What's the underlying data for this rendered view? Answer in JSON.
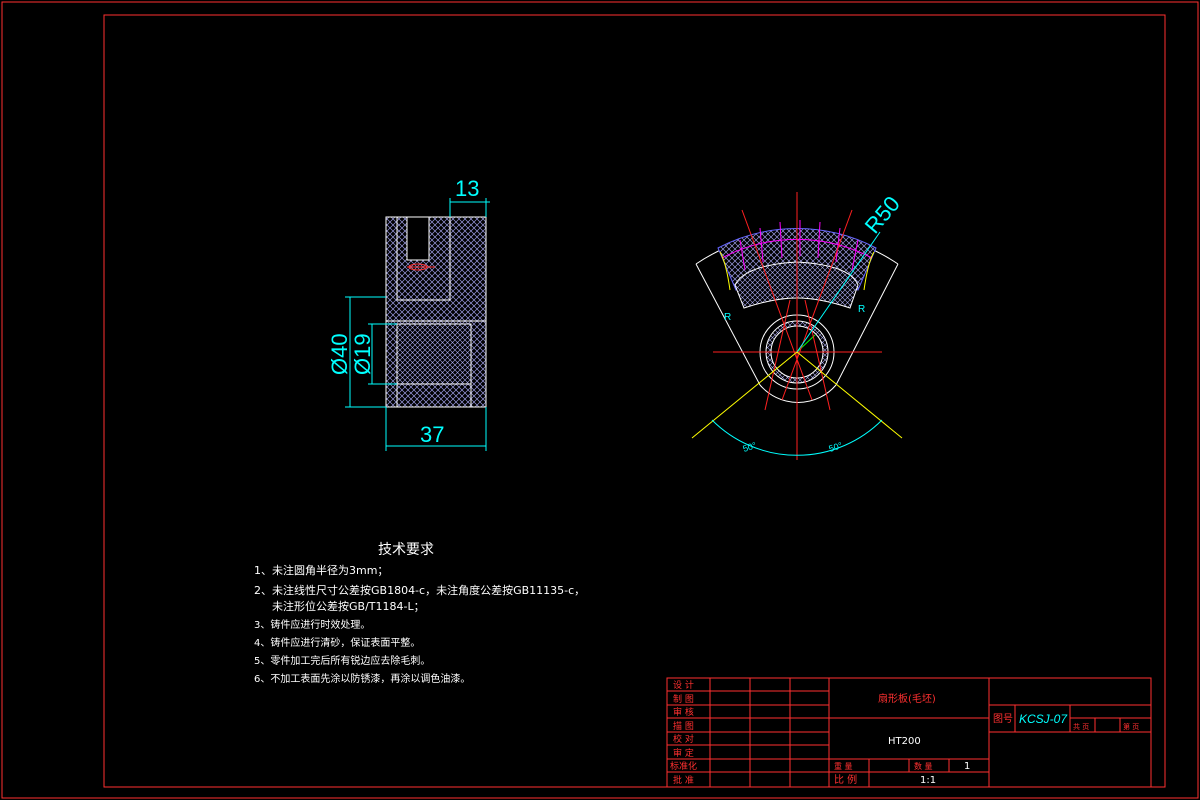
{
  "drawing": {
    "dimensions": {
      "width_top": "13",
      "diameter_outer": "Ø40",
      "diameter_inner": "Ø19",
      "length": "37",
      "radius": "R50",
      "angle_left": "50°",
      "angle_right": "50°",
      "small_r_left": "R",
      "small_r_right": "R"
    }
  },
  "requirements": {
    "title": "技术要求",
    "items": [
      "1、未注圆角半径为3mm；",
      "2、未注线性尺寸公差按GB1804-c，未注角度公差按GB11135-c，",
      "未注形位公差按GB/T1184-L；",
      "3、铸件应进行时效处理。",
      "4、铸件应进行清砂，保证表面平整。",
      "5、零件加工完后所有锐边应去除毛刺。",
      "6、不加工表面先涂以防锈漆，再涂以调色油漆。"
    ]
  },
  "title_block": {
    "roles": [
      "设 计",
      "制 图",
      "审 核",
      "描 图",
      "校 对",
      "审 定",
      "标准化",
      "批 准"
    ],
    "part_name": "扇形板(毛坯)",
    "material": "HT200",
    "drawing_no_label": "图号",
    "drawing_no": "KCSJ-07",
    "sheet_labels": [
      "共 页",
      "第 页"
    ],
    "weight_label": "重 量",
    "count_label": "数 量",
    "count_value": "1",
    "scale_label": "比 例",
    "scale_value": "1:1"
  },
  "colors": {
    "frame": "#ff3030",
    "dimension": "#00ffff",
    "center": "#ff2020",
    "hatch_light": "#aaaaff",
    "hatch_dark": "#8888cc",
    "outline": "#ffffff",
    "gear_magenta": "#ff00ff",
    "gear_blue": "#6666ff",
    "guide_yellow": "#ffff00",
    "label": "#ffffff"
  }
}
